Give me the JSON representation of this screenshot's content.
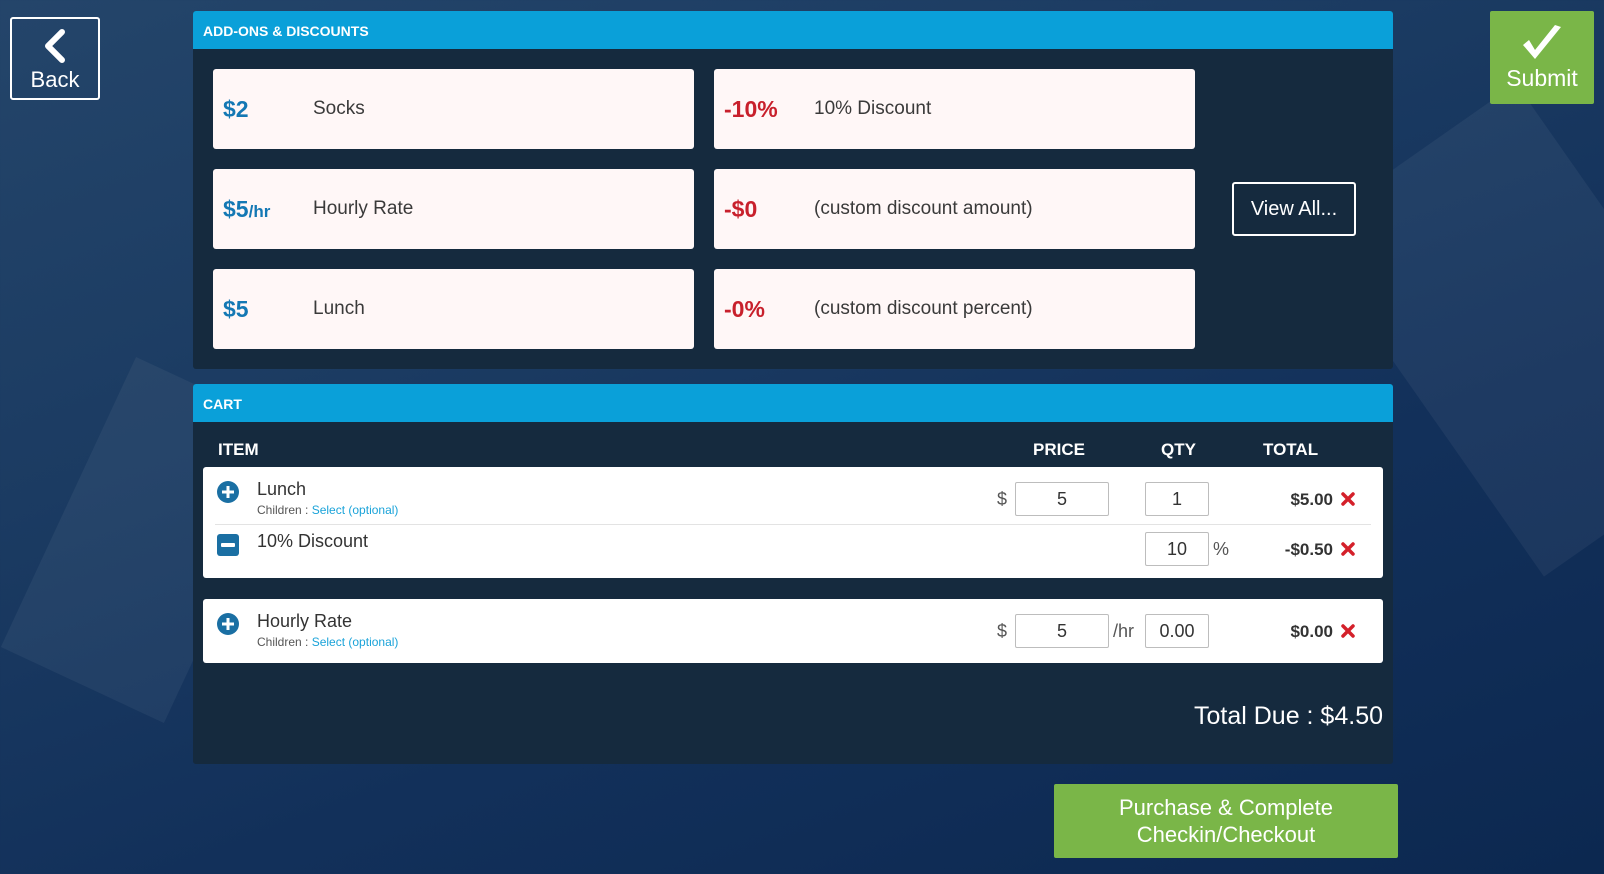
{
  "nav": {
    "back_label": "Back",
    "submit_label": "Submit"
  },
  "addons": {
    "header": "ADD-ONS & DISCOUNTS",
    "tiles": [
      {
        "price": "$2",
        "unit": "",
        "name": "Socks"
      },
      {
        "price": "$5",
        "unit": "/hr",
        "name": "Hourly Rate"
      },
      {
        "price": "$5",
        "unit": "",
        "name": "Lunch"
      }
    ],
    "discounts": [
      {
        "price": "-10%",
        "name": "10% Discount"
      },
      {
        "price": "-$0",
        "name": "(custom discount amount)"
      },
      {
        "price": "-0%",
        "name": "(custom discount percent)"
      }
    ],
    "view_all_label": "View All..."
  },
  "cart": {
    "header": "CART",
    "columns": {
      "item": "ITEM",
      "price": "PRICE",
      "qty": "QTY",
      "total": "TOTAL"
    },
    "children_label": "Children :",
    "select_label": "Select (optional)",
    "currency": "$",
    "rows": [
      {
        "name": "Lunch",
        "price": "5",
        "qty": "1",
        "total": "$5.00"
      },
      {
        "name": "10% Discount",
        "percent": "10",
        "percent_sign": "%",
        "total": "-$0.50"
      },
      {
        "name": "Hourly Rate",
        "price": "5",
        "unit": "/hr",
        "qty": "0.00",
        "total": "$0.00"
      }
    ],
    "total_due": "Total Due : $4.50"
  },
  "purchase": {
    "line1": "Purchase & Complete",
    "line2": "Checkin/Checkout"
  },
  "colors": {
    "accent_blue": "#0aa0d9",
    "green": "#7ab648",
    "discount_red": "#c8202c",
    "price_blue": "#1478b4"
  }
}
